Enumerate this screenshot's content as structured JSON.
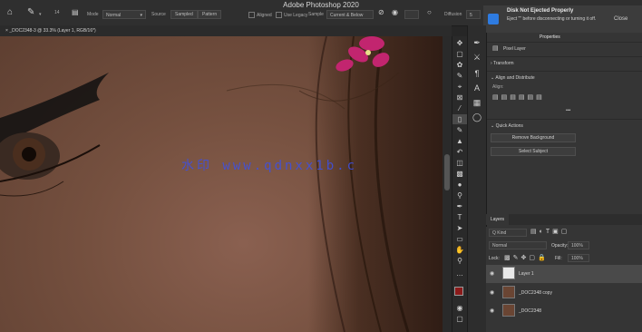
{
  "app": {
    "title": "Adobe Photoshop 2020"
  },
  "options_bar": {
    "brush_size": "14",
    "mode_label": "Mode",
    "mode_value": "Normal",
    "source_label": "Source",
    "sampled_btn": "Sampled",
    "pattern_btn": "Pattern",
    "aligned_label": "Aligned",
    "use_legacy_label": "Use Legacy",
    "sample_label": "Sample",
    "sample_value": "Current & Below",
    "diffusion_label": "Diffusion",
    "diffusion_value": "5"
  },
  "notification": {
    "title": "Disk Not Ejected Properly",
    "body": "Eject \"\" before disconnecting or turning it off.",
    "close": "Close"
  },
  "document_tab": {
    "label": "_DOC2348-3 @ 33.3% (Layer 1, RGB/16*)"
  },
  "canvas": {
    "watermark": "水印 www.qdnxx1b.c"
  },
  "tools": [
    "move-tool",
    "artboard-tool",
    "lasso-tool",
    "quick-select-tool",
    "crop-tool",
    "frame-tool",
    "eyedropper-tool",
    "healing-brush-tool",
    "brush-tool",
    "clone-stamp-tool",
    "history-brush-tool",
    "eraser-tool",
    "gradient-tool",
    "blur-tool",
    "dodge-tool",
    "pen-tool",
    "type-tool",
    "path-select-tool",
    "rectangle-tool",
    "hand-tool",
    "zoom-tool"
  ],
  "panels": {
    "tab_active": "Properties",
    "pixel_layer_label": "Pixel Layer",
    "transform_label": "Transform",
    "align_label": "Align and Distribute",
    "align_sub": "Align:",
    "more_dots": "•••",
    "quick_actions_label": "Quick Actions",
    "remove_bg_btn": "Remove Background",
    "select_subject_btn": "Select Subject"
  },
  "layers": {
    "tab": "Layers",
    "kind_label": "Q Kind",
    "blend_mode": "Normal",
    "opacity_label": "Opacity:",
    "opacity_value": "100%",
    "lock_label": "Lock:",
    "fill_label": "Fill:",
    "fill_value": "100%",
    "items": [
      {
        "name": "Layer 1",
        "selected": true,
        "thumb": "#e8e8e8"
      },
      {
        "name": "_DOC2348 copy",
        "selected": false,
        "thumb": "#6a4533"
      },
      {
        "name": "_DOC2348",
        "selected": false,
        "thumb": "#6a4533"
      }
    ]
  },
  "colors": {
    "foreground": "#8b1a1a",
    "background": "#ffffff",
    "flower": "#c2256f",
    "watermark": "#3c50e6"
  }
}
